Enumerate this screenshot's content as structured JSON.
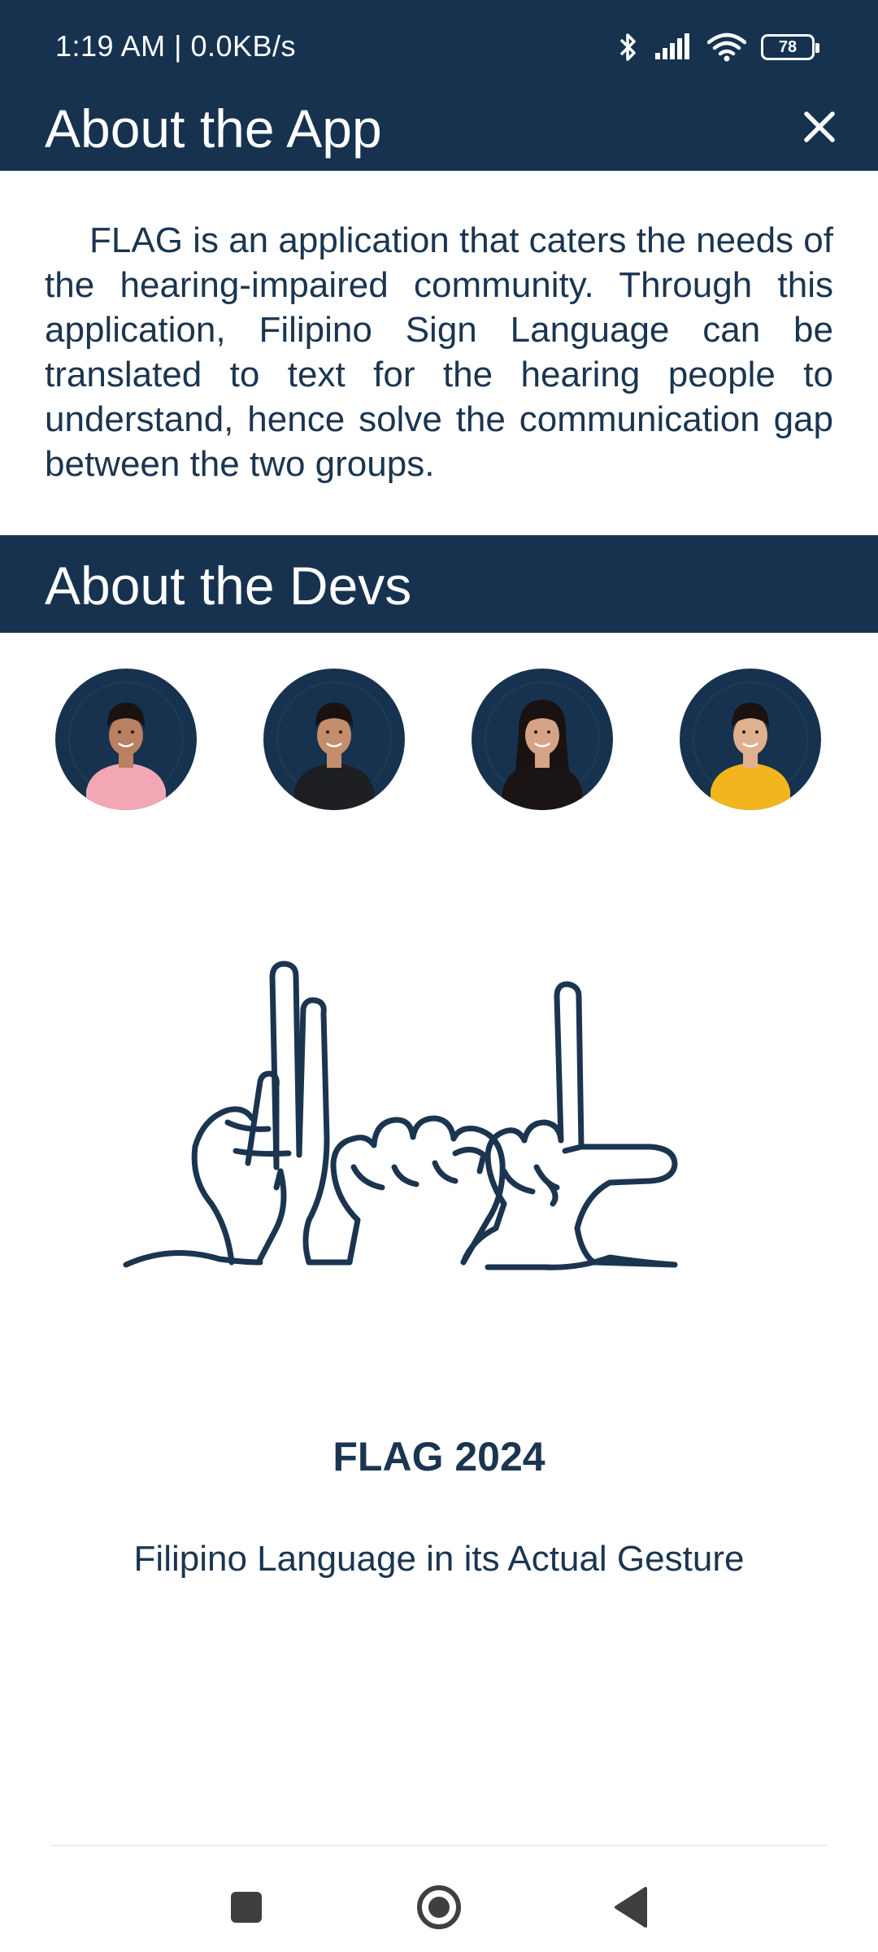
{
  "status_bar": {
    "time_speed": "1:19 AM | 0.0KB/s",
    "battery_level": "78",
    "icons": [
      "bluetooth-icon",
      "signal-icon",
      "wifi-icon",
      "battery-icon"
    ]
  },
  "header": {
    "title": "About the App",
    "close_icon": "close-icon"
  },
  "about": {
    "text": "FLAG is an application that caters the needs of the hearing-impaired community. Through this application, Filipino Sign Language can be translated to text for the hearing people to understand, hence solve the communication gap between the two groups."
  },
  "devs": {
    "title": "About the Devs",
    "avatars": [
      {
        "shirt_color": "#f3a7b5",
        "skin": "#b98061"
      },
      {
        "shirt_color": "#1d1f22",
        "skin": "#c48e6c"
      },
      {
        "shirt_color": "#1a1414",
        "skin": "#d6a387",
        "long_hair": true
      },
      {
        "shirt_color": "#f2b51e",
        "skin": "#e0b18e"
      }
    ]
  },
  "footer": {
    "title": "FLAG 2024",
    "subtitle": "Filipino Language in its Actual Gesture"
  },
  "nav": {
    "icons": [
      "recent-apps-icon",
      "home-icon",
      "back-icon"
    ]
  },
  "colors": {
    "primary": "#16324f",
    "text": "#1b3550",
    "background": "#ffffff"
  }
}
